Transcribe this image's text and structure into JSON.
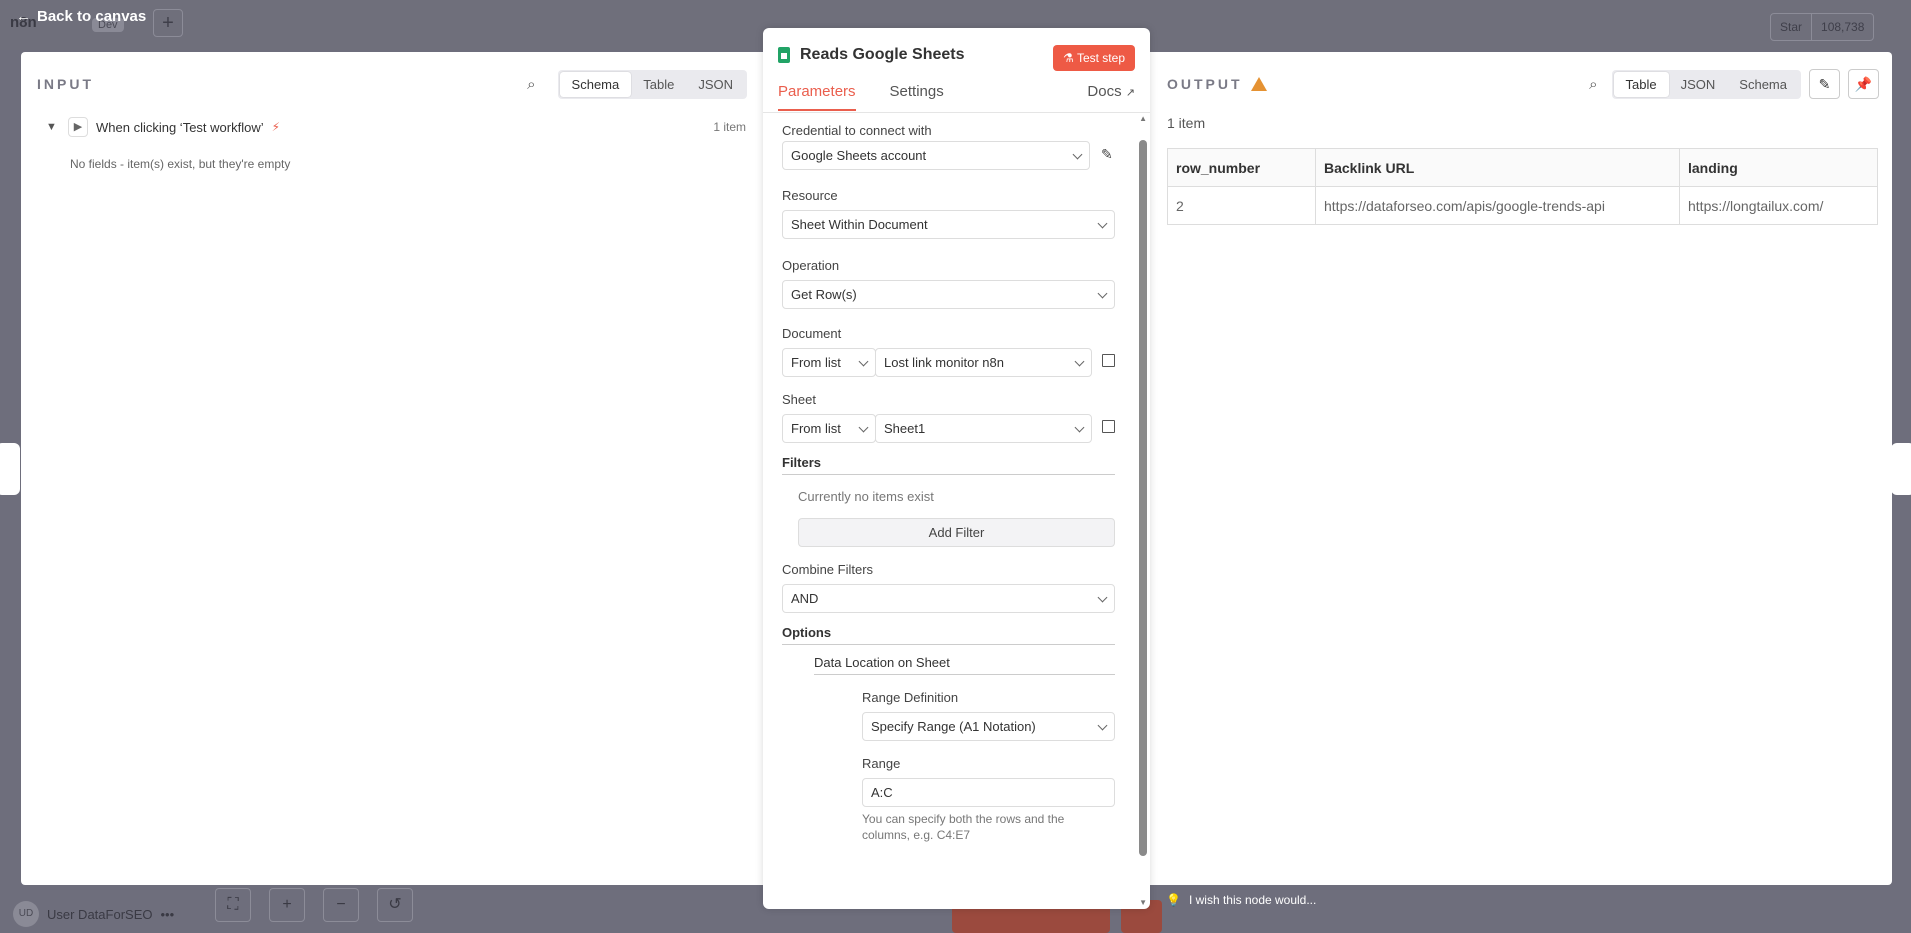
{
  "app": {
    "back_label": "Back to canvas",
    "logo_text": "n8n",
    "env_badge": "Dev",
    "star_label": "Star",
    "star_count": "108,738",
    "user_name": "User DataForSEO",
    "user_initials": "UD",
    "wish_text": "I wish this node would..."
  },
  "input": {
    "title": "INPUT",
    "view_tabs": [
      "Schema",
      "Table",
      "JSON"
    ],
    "active_view": "Schema",
    "trigger_label": "When clicking ‘Test workflow’",
    "item_count": "1 item",
    "empty_message": "No fields - item(s) exist, but they're empty"
  },
  "node": {
    "title": "Reads Google Sheets",
    "test_button": "Test step",
    "tabs": [
      "Parameters",
      "Settings",
      "Docs"
    ],
    "active_tab": "Parameters",
    "credential_label": "Credential to connect with",
    "credential_value": "Google Sheets account",
    "resource_label": "Resource",
    "resource_value": "Sheet Within Document",
    "operation_label": "Operation",
    "operation_value": "Get Row(s)",
    "document_label": "Document",
    "document_mode": "From list",
    "document_value": "Lost link monitor n8n",
    "sheet_label": "Sheet",
    "sheet_mode": "From list",
    "sheet_value": "Sheet1",
    "filters_label": "Filters",
    "filters_empty": "Currently no items exist",
    "add_filter": "Add Filter",
    "combine_label": "Combine Filters",
    "combine_value": "AND",
    "options_label": "Options",
    "data_location_label": "Data Location on Sheet",
    "range_def_label": "Range Definition",
    "range_def_value": "Specify Range (A1 Notation)",
    "range_label": "Range",
    "range_value": "A:C",
    "range_hint": "You can specify both the rows and the columns, e.g. C4:E7"
  },
  "output": {
    "title": "OUTPUT",
    "view_tabs": [
      "Table",
      "JSON",
      "Schema"
    ],
    "active_view": "Table",
    "item_count": "1 item",
    "columns": [
      "row_number",
      "Backlink URL",
      "landing"
    ],
    "rows": [
      [
        "2",
        "https://dataforseo.com/apis/google-trends-api",
        "https://longtailux.com/"
      ]
    ]
  },
  "colors": {
    "accent": "#ea5e4d",
    "warning": "#e59232",
    "sheets_green": "#21a366"
  }
}
